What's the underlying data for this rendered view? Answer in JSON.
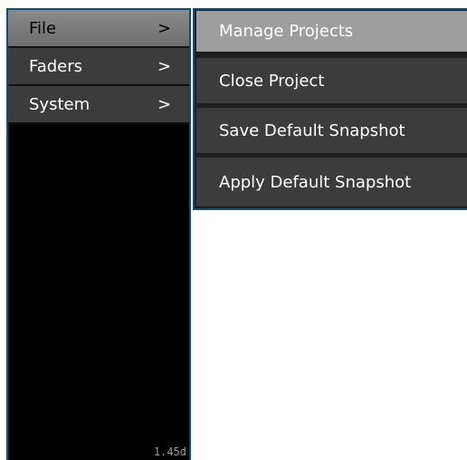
{
  "main_menu": {
    "items": [
      {
        "label": "File",
        "arrow": ">"
      },
      {
        "label": "Faders",
        "arrow": ">"
      },
      {
        "label": "System",
        "arrow": ">"
      }
    ],
    "version": "1.45d"
  },
  "file_submenu": {
    "items": [
      {
        "label": "Manage Projects"
      },
      {
        "label": "Close Project"
      },
      {
        "label": "Save Default Snapshot"
      },
      {
        "label": "Apply Default Snapshot"
      }
    ]
  },
  "colors": {
    "border": "#0e4d74",
    "item_bg": "#3c3c3c",
    "active_bg": "#8a8a8a",
    "highlight_bg": "#9e9e9e",
    "panel_bg": "#000000"
  }
}
